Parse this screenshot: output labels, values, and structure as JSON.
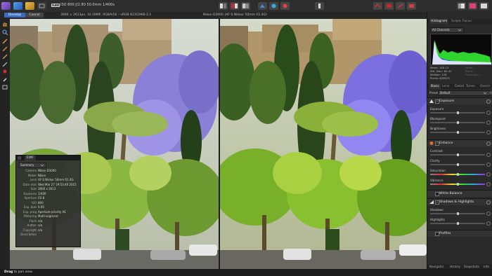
{
  "toolbar": {
    "personas": [
      {
        "name": "photo-persona",
        "color": "#7a56c8"
      },
      {
        "name": "liquify-persona",
        "color": "#3a86c8"
      },
      {
        "name": "develop-persona",
        "color": "#d0a030"
      }
    ],
    "raw_badge": "RAW",
    "exposure_info": "ISO 800 ƒ/2.80 50.0mm 1/400s"
  },
  "subbar": {
    "develop_label": "Develop",
    "cancel_label": "Cancel",
    "image_info": "3900 × 2613px, 10.19MP, RGBA/16 – sRGB IEC61966-2.1",
    "camera_info": "Nikon D3000 (AF-S Nikkor 50mm f/1.4G)"
  },
  "exif": {
    "tab_label": "EXIF",
    "mode": "Summary",
    "rows": [
      {
        "key": "Camera",
        "value": "Nikon D3000"
      },
      {
        "key": "Maker",
        "value": "Nikon"
      },
      {
        "key": "Lens",
        "value": "AF-S Nikkor 50mm f/1.4G"
      },
      {
        "key": "Date shot",
        "value": "Wed Mar 27 19:53:46 2015"
      },
      {
        "key": "Size",
        "value": "3900 x 2613"
      },
      {
        "key": "Exposure",
        "value": "1/400"
      },
      {
        "key": "Aperture",
        "value": "f/2.8"
      },
      {
        "key": "ISO",
        "value": "800"
      },
      {
        "key": "Exp. bias",
        "value": "0.00"
      },
      {
        "key": "Exp. prog",
        "value": "Aperture-priority AE"
      },
      {
        "key": "Metering",
        "value": "Multi-segment"
      },
      {
        "key": "Flash",
        "value": "n/a"
      },
      {
        "key": "Author",
        "value": "n/a"
      },
      {
        "key": "Copyright",
        "value": "n/a"
      },
      {
        "key": "Description",
        "value": ""
      }
    ]
  },
  "panel": {
    "top_tabs": [
      "Histogram",
      "Scope",
      "Focus"
    ],
    "channel": "All Channels",
    "stats_left": [
      "Mean: 148.13",
      "Std. Dev.: 83.42",
      "Median: 128",
      "Pixels: 639675"
    ],
    "stats_right": [
      "Level: -",
      "Pixels: -",
      "Percentile: -"
    ],
    "adjust_tabs": [
      "Basic",
      "Lens",
      "Detail",
      "Tones",
      "Overlays"
    ],
    "preset_label": "Preset:",
    "preset_value": "Default",
    "sections": {
      "exposure": "Exposure",
      "enhance": "Enhance",
      "white_balance": "White Balance",
      "shadows_highlights": "Shadows & Highlights",
      "profiles": "Profiles"
    },
    "sliders": {
      "exposure": {
        "label": "Exposure",
        "value": 0.5
      },
      "blackpoint": {
        "label": "Blackpoint",
        "value": 0.5
      },
      "brightness": {
        "label": "Brightness",
        "value": 0.5
      },
      "contrast": {
        "label": "Contrast",
        "value": 0.5
      },
      "clarity": {
        "label": "Clarity",
        "value": 0.5
      },
      "saturation": {
        "label": "Saturation",
        "value": 0.5
      },
      "vibrance": {
        "label": "Vibrance",
        "value": 0.5
      },
      "shadows": {
        "label": "Shadows",
        "value": 0.5
      },
      "highlights": {
        "label": "Highlights",
        "value": 0.5
      }
    },
    "bottom_tabs": [
      "Navigator",
      "History",
      "Snapshots",
      "Info"
    ]
  },
  "status": {
    "action": "Drag",
    "message": "to pan view."
  },
  "colors": {
    "accent": "#3a6bbf",
    "histogram_green": "#2fd42f",
    "histogram_blue": "#2a3cff",
    "histogram_white": "#ffffff"
  }
}
